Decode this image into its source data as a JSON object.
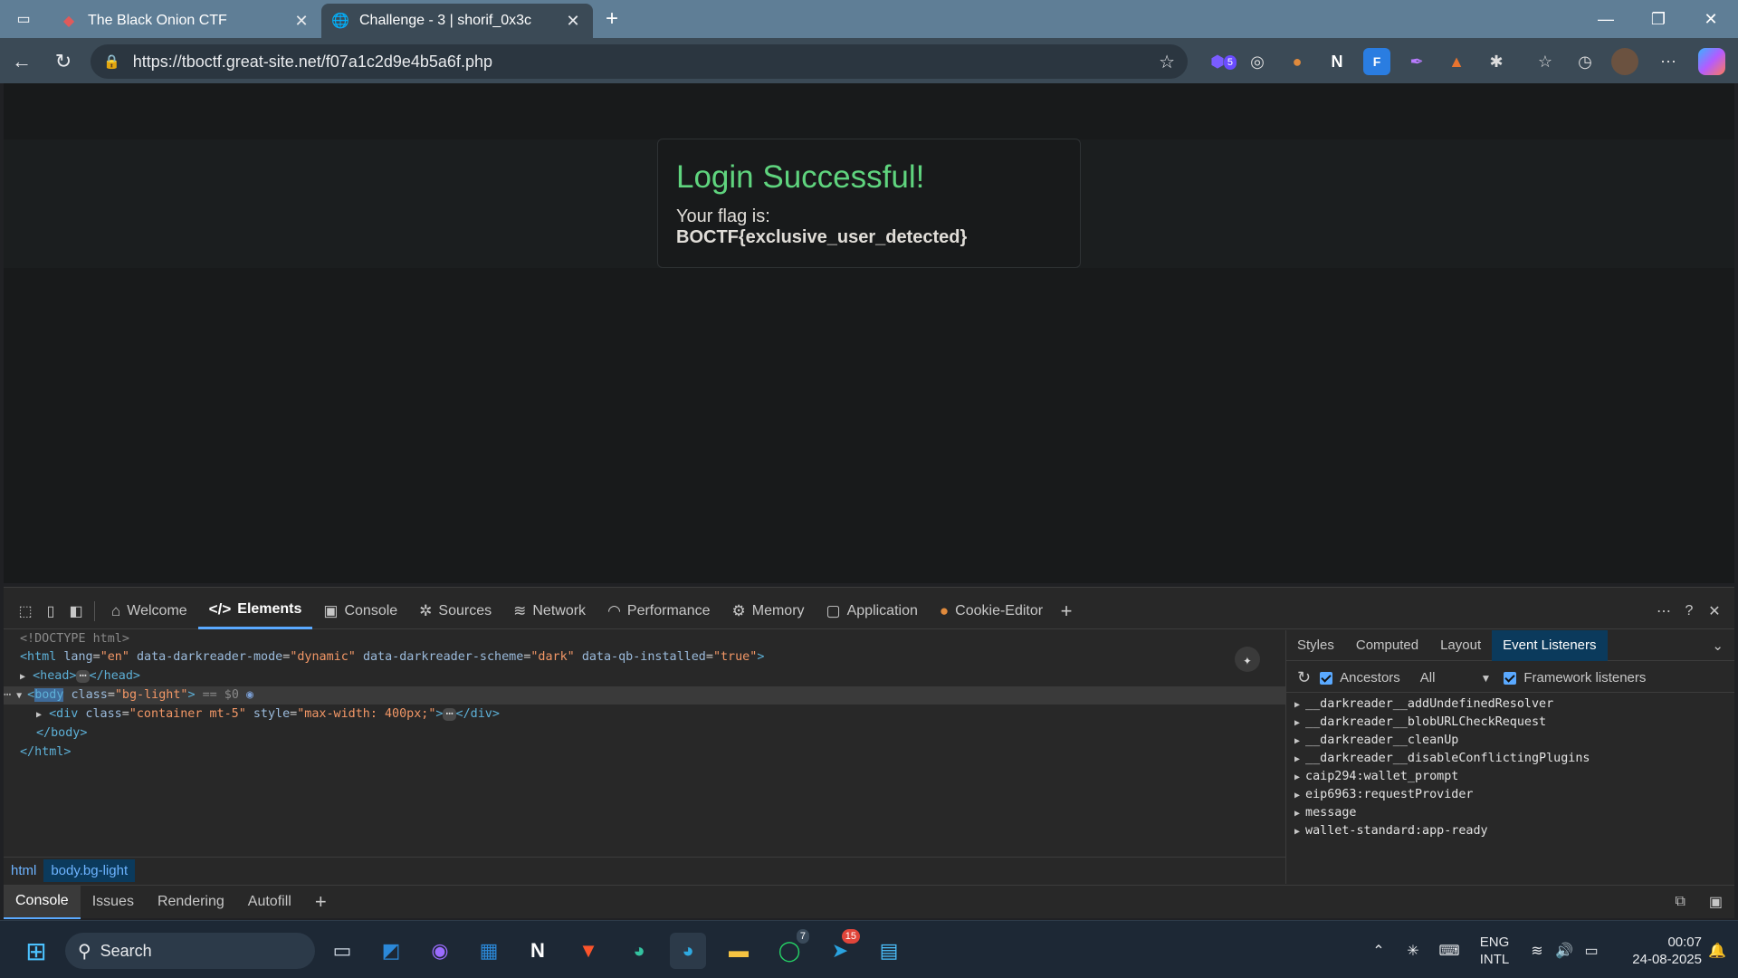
{
  "browser": {
    "tabs": [
      {
        "title": "The Black Onion CTF",
        "active": false
      },
      {
        "title": "Challenge - 3 | shorif_0x3c",
        "active": true
      }
    ],
    "url": "https://tboctf.great-site.net/f07a1c2d9e4b5a6f.php",
    "extension_badge": "5"
  },
  "page": {
    "heading": "Login Successful!",
    "flag_prefix": "Your flag is: ",
    "flag_value": "BOCTF{exclusive_user_detected}"
  },
  "devtools": {
    "tabs": [
      "Welcome",
      "Elements",
      "Console",
      "Sources",
      "Network",
      "Performance",
      "Memory",
      "Application",
      "Cookie-Editor"
    ],
    "active_tab": "Elements",
    "dom": {
      "doctype": "<!DOCTYPE html>",
      "html_open": "<html",
      "html_attr_lang_name": "lang",
      "html_attr_lang_value": "\"en\"",
      "html_attr_mode_name": "data-darkreader-mode",
      "html_attr_mode_value": "\"dynamic\"",
      "html_attr_scheme_name": "data-darkreader-scheme",
      "html_attr_scheme_value": "\"dark\"",
      "html_attr_qb_name": "data-qb-installed",
      "html_attr_qb_value": "\"true\"",
      "head_open": "<head>",
      "head_close": "</head>",
      "body_tag": "body",
      "body_class_name": "class",
      "body_class_value": "\"bg-light\"",
      "selected_marker": "== $0",
      "div_open": "<div",
      "div_class_name": "class",
      "div_class_value": "\"container mt-5\"",
      "div_style_name": "style",
      "div_style_value": "\"max-width: 400px;\"",
      "div_close": "</div>",
      "body_close": "</body>",
      "html_close": "</html>"
    },
    "breadcrumb": [
      "html",
      "body.bg-light"
    ],
    "side_tabs": [
      "Styles",
      "Computed",
      "Layout",
      "Event Listeners"
    ],
    "side_active": "Event Listeners",
    "filter": {
      "ancestors": "Ancestors",
      "scope": "All",
      "framework": "Framework listeners"
    },
    "listeners": [
      "__darkreader__addUndefinedResolver",
      "__darkreader__blobURLCheckRequest",
      "__darkreader__cleanUp",
      "__darkreader__disableConflictingPlugins",
      "caip294:wallet_prompt",
      "eip6963:requestProvider",
      "message",
      "wallet-standard:app-ready"
    ],
    "drawer_tabs": [
      "Console",
      "Issues",
      "Rendering",
      "Autofill"
    ]
  },
  "taskbar": {
    "search_placeholder": "Search",
    "whatsapp_badge": "7",
    "telegram_badge": "15",
    "lang_top": "ENG",
    "lang_bottom": "INTL",
    "time": "00:07",
    "date": "24-08-2025"
  },
  "colors": {
    "heading_green": "#5fd47e",
    "accent_blue": "#5aa9ff",
    "titlebar": "#5f7e96"
  }
}
